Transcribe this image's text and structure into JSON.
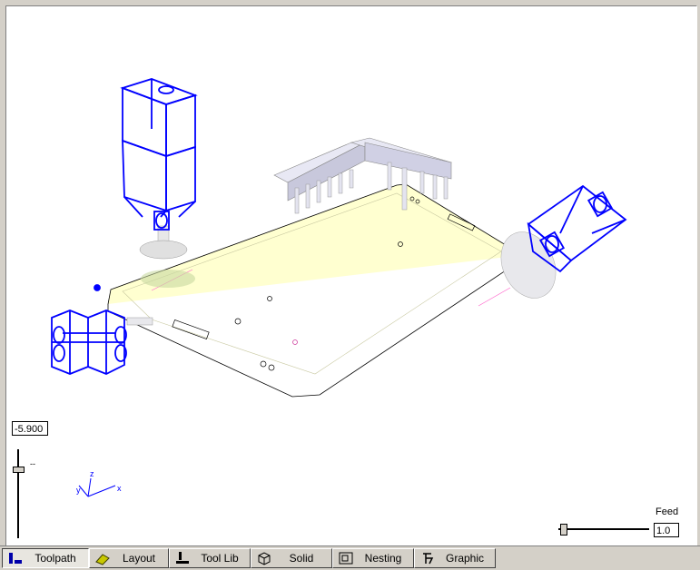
{
  "viewport": {
    "z_value": "-5.900",
    "vslider_tick": "--",
    "feed_label": "Feed",
    "feed_value": "1.0",
    "axes": {
      "x": "x",
      "y": "y",
      "z": "z"
    }
  },
  "tabs": [
    {
      "label": "Toolpath",
      "icon": "toolpath-icon",
      "active": true
    },
    {
      "label": "Layout",
      "icon": "layout-icon",
      "active": false
    },
    {
      "label": "Tool Lib",
      "icon": "tool-lib-icon",
      "active": false
    },
    {
      "label": "Solid",
      "icon": "solid-icon",
      "active": false
    },
    {
      "label": "Nesting",
      "icon": "nesting-icon",
      "active": false
    },
    {
      "label": "Graphic",
      "icon": "graphic-icon",
      "active": false
    }
  ],
  "colors": {
    "wireframe": "#0000ff",
    "panel": "#ffffcc",
    "rail": "#e0e0f0",
    "background": "#ffffff",
    "chrome": "#d4d0c8"
  }
}
